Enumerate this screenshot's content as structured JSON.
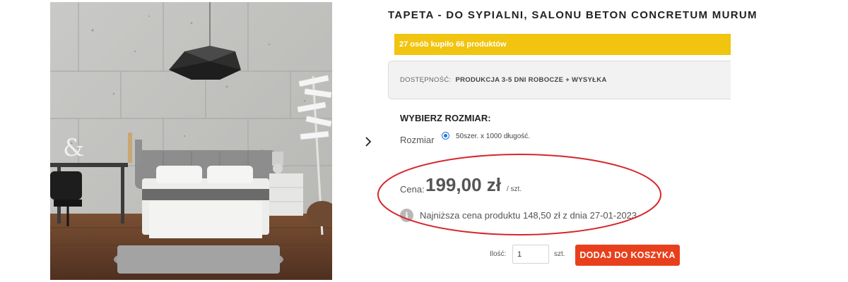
{
  "product": {
    "title": "TAPETA - DO SYPIALNI, SALONU BETON CONCRETUM MURUM",
    "sold_banner": "27 osób kupiło 66 produktów",
    "availability_label": "DOSTĘPNOŚĆ:",
    "availability_value": "PRODUKCJA 3-5 DNI ROBOCZE + WYSYŁKA",
    "size_heading": "WYBIERZ ROZMIAR:",
    "size_label": "Rozmiar",
    "size_option": "50szer. x 1000 długość.",
    "price_label": "Cena:",
    "price_value": "199,00 zł",
    "price_unit": "/ szt.",
    "lowest_price": "Najniższa cena produktu 148,50 zł z dnia 27-01-2023",
    "qty_label": "Ilość:",
    "qty_value": "1",
    "qty_unit": "szt.",
    "add_to_cart": "DODAJ DO KOSZYKA"
  },
  "icons": {
    "next": "chevron-right-icon",
    "info": "info-icon"
  },
  "colors": {
    "banner": "#f1c40f",
    "add_button": "#e8401c",
    "highlight": "#d7262b"
  }
}
